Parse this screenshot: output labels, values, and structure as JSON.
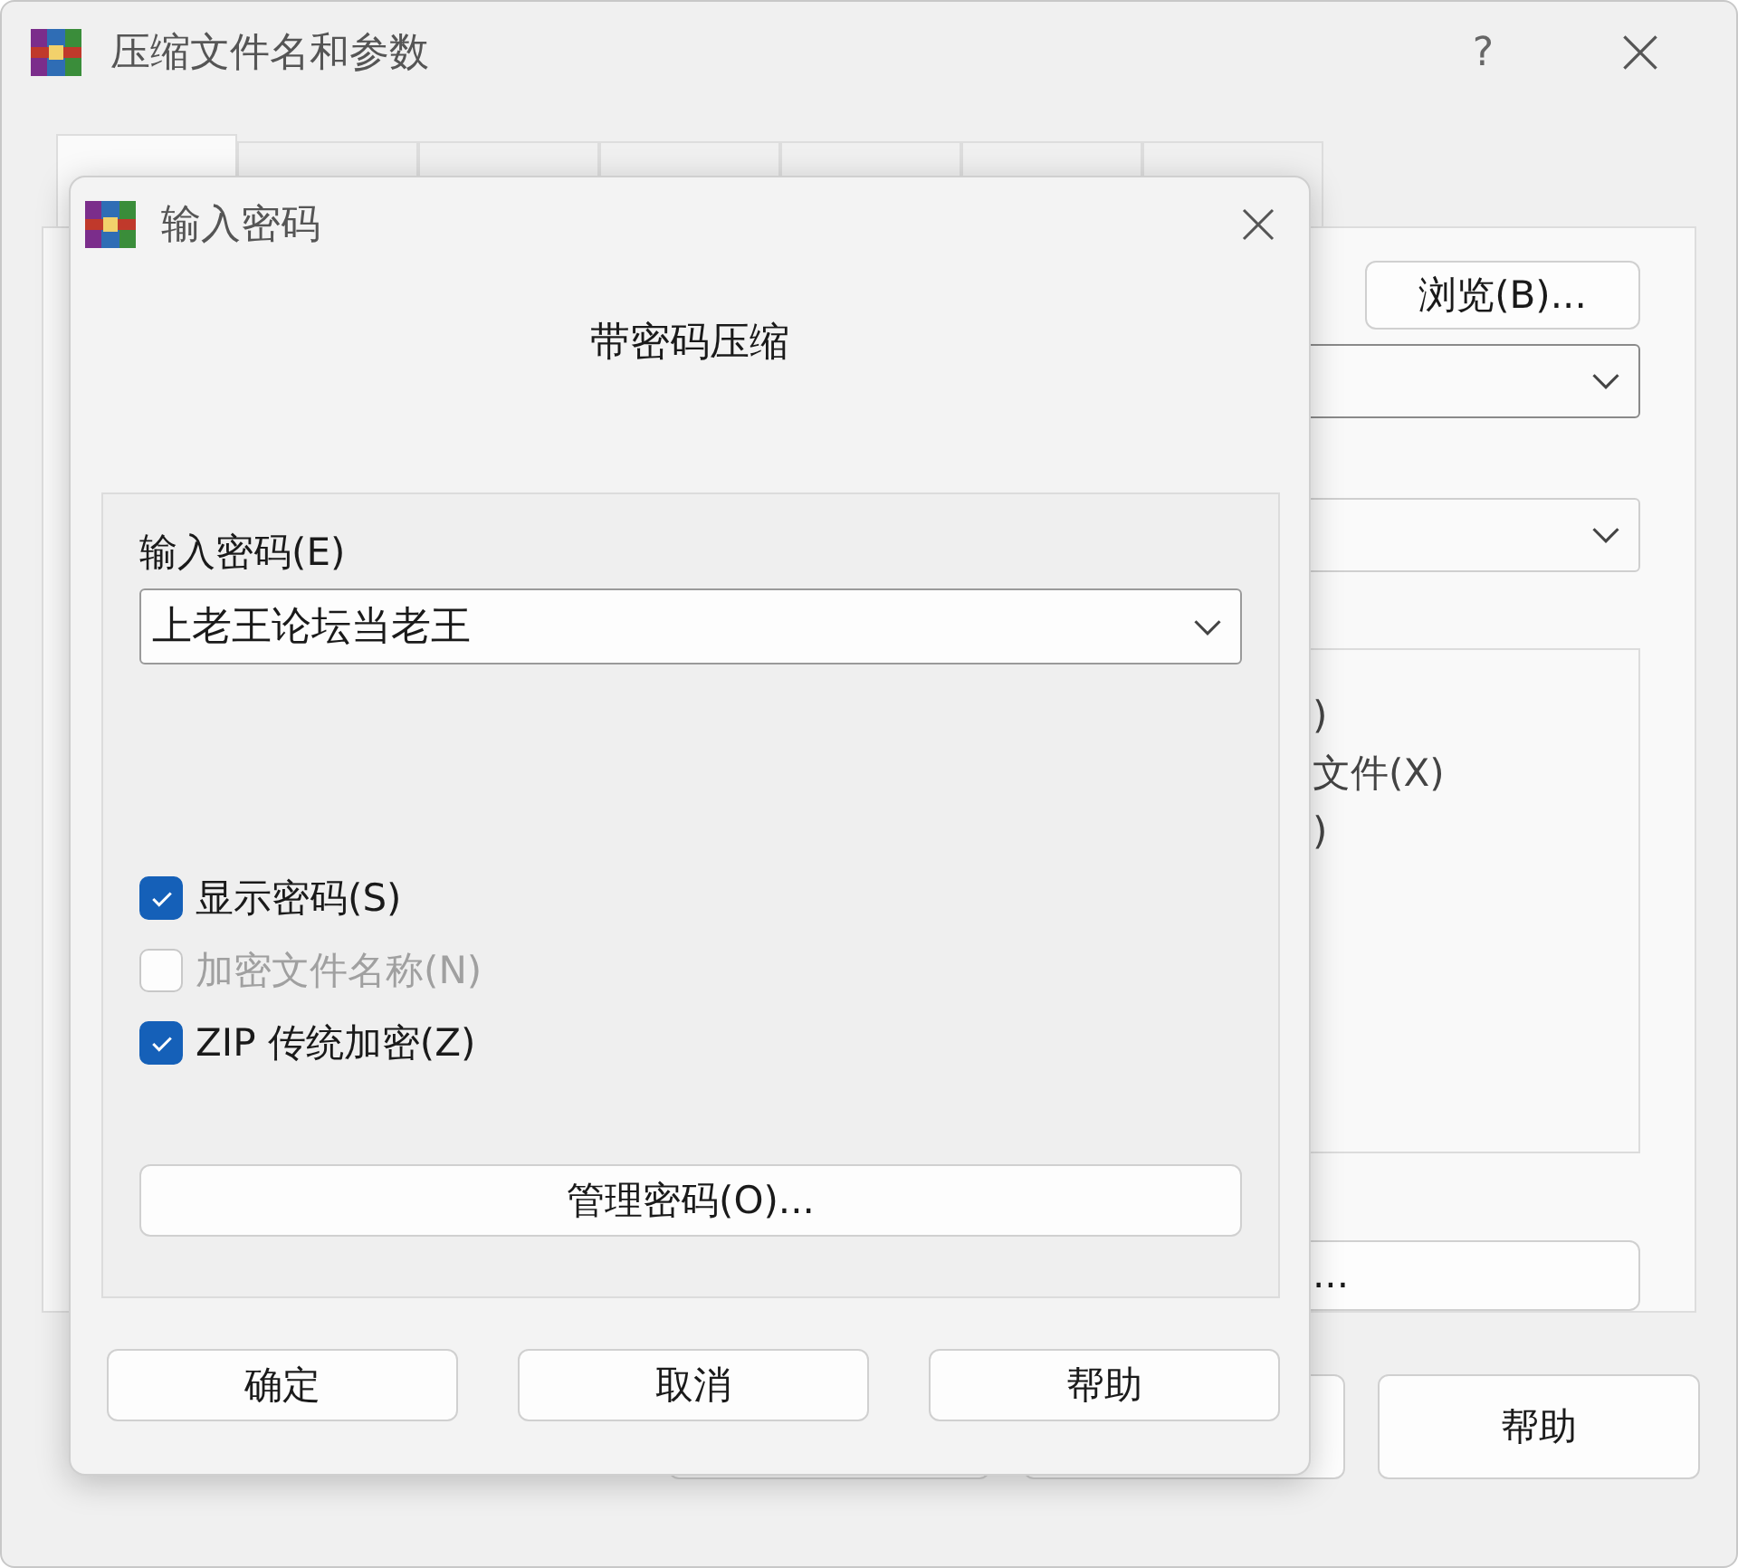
{
  "main_window": {
    "title": "压缩文件名和参数",
    "help_glyph": "?",
    "tabs": [
      {
        "selected": true
      },
      {
        "selected": false
      },
      {
        "selected": false
      },
      {
        "selected": false
      },
      {
        "selected": false
      },
      {
        "selected": false
      },
      {
        "selected": false
      }
    ],
    "browse_button": "浏览(B)...",
    "group_fragments": [
      ")",
      "文件(X)",
      ")"
    ],
    "partial_button": "...",
    "help_button": "帮助"
  },
  "dialog": {
    "title": "输入密码",
    "heading": "带密码压缩",
    "password_label": "输入密码(E)",
    "password_value": "上老王论坛当老王",
    "options": [
      {
        "label": "显示密码(S)",
        "checked": true,
        "disabled": false
      },
      {
        "label": "加密文件名称(N)",
        "checked": false,
        "disabled": true
      },
      {
        "label": "ZIP 传统加密(Z)",
        "checked": true,
        "disabled": false
      }
    ],
    "manage_button": "管理密码(O)...",
    "buttons": [
      "确定",
      "取消",
      "帮助"
    ]
  }
}
